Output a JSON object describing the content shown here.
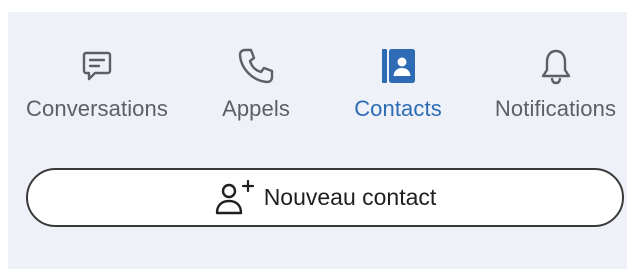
{
  "tabs": [
    {
      "id": "conversations",
      "label": "Conversations",
      "icon": "chat-icon",
      "active": false
    },
    {
      "id": "appels",
      "label": "Appels",
      "icon": "phone-icon",
      "active": false
    },
    {
      "id": "contacts",
      "label": "Contacts",
      "icon": "contact-book-icon",
      "active": true
    },
    {
      "id": "notifications",
      "label": "Notifications",
      "icon": "bell-icon",
      "active": false
    }
  ],
  "new_contact": {
    "label": "Nouveau contact",
    "icon": "add-person-icon"
  },
  "colors": {
    "panel_bg": "#eef1f7",
    "inactive": "#5b5f66",
    "active": "#2d6cb5",
    "button_border": "#3a3a3a"
  }
}
